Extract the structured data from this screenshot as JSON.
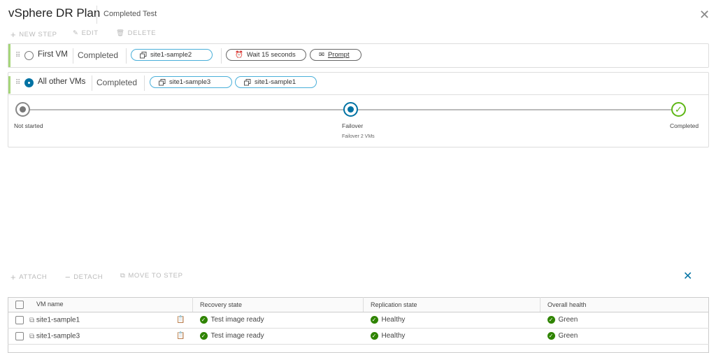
{
  "header": {
    "title": "vSphere DR Plan",
    "subtitle": "Completed Test",
    "close_icon": "close-icon"
  },
  "toolbar": {
    "new_step": "NEW STEP",
    "edit": "EDIT",
    "delete": "DELETE"
  },
  "steps": [
    {
      "name": "First VM",
      "status": "Completed",
      "selected": false,
      "vms": [
        "site1-sample2"
      ],
      "actions": [
        "Wait 15 seconds",
        "Prompt"
      ]
    },
    {
      "name": "All other VMs",
      "status": "Completed",
      "selected": true,
      "vms": [
        "site1-sample3",
        "site1-sample1"
      ],
      "progress": [
        {
          "label": "Not started",
          "state": "done"
        },
        {
          "label": "Failover",
          "detail": "Failover 2 VMs",
          "state": "current"
        },
        {
          "label": "Completed",
          "state": "complete"
        }
      ]
    }
  ],
  "vm_toolbar": {
    "attach": "ATTACH",
    "detach": "DETACH",
    "move": "MOVE TO STEP"
  },
  "table": {
    "columns": [
      "VM name",
      "Recovery state",
      "Replication state",
      "Overall health"
    ],
    "rows": [
      [
        "site1-sample1",
        "Test image ready",
        "Healthy",
        "Green"
      ],
      [
        "site1-sample3",
        "Test image ready",
        "Healthy",
        "Green"
      ]
    ]
  },
  "colors": {
    "accent": "#0072a3",
    "success": "#2f8400",
    "step_bar": "#a6d67a",
    "pill_border": "#49afd9"
  }
}
